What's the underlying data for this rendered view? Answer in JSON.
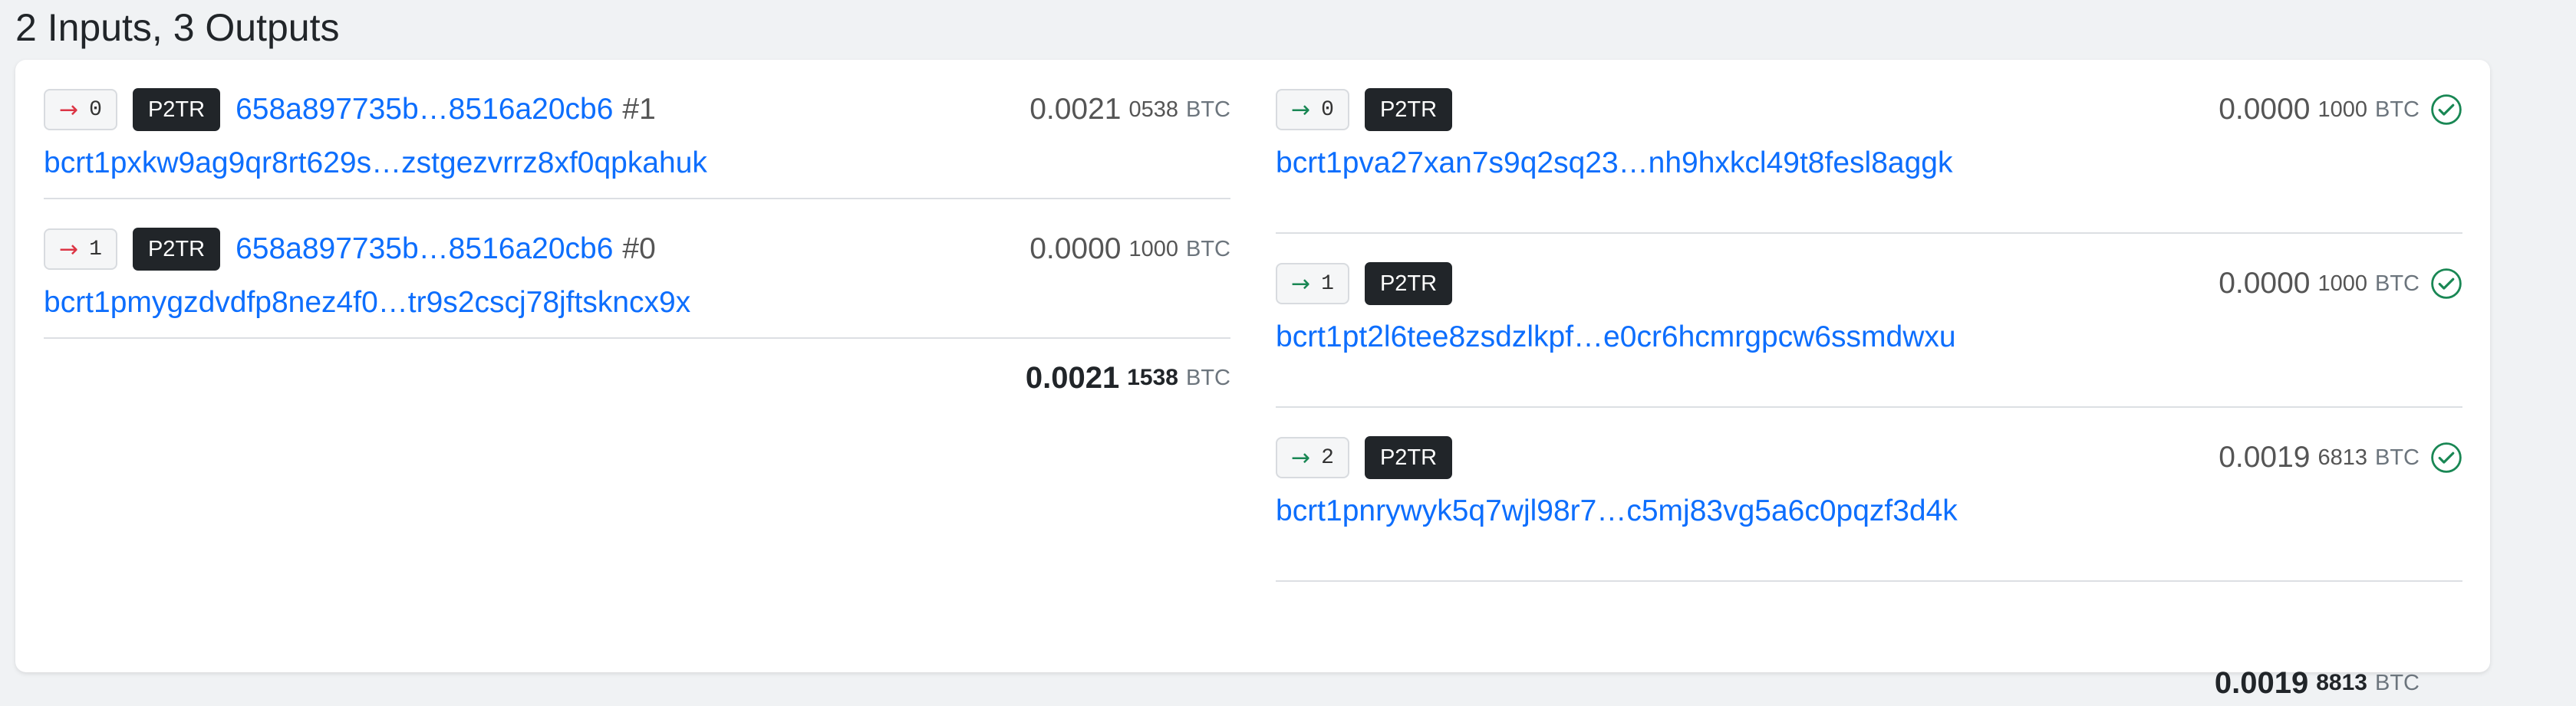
{
  "heading": "2 Inputs, 3 Outputs",
  "colors": {
    "link": "#0d6efd",
    "input_arrow": "#dc3545",
    "output_arrow": "#198754",
    "badge_bg": "#212529"
  },
  "inputs": [
    {
      "arrow": "→",
      "index": "0",
      "type": "P2TR",
      "txid": "658a897735b…8516a20cb6",
      "vout": "#1",
      "amount_main": "0.0021",
      "amount_small": "0538",
      "unit": "BTC",
      "address": "bcrt1pxkw9ag9qr8rt629s…zstgezvrrz8xf0qpkahuk"
    },
    {
      "arrow": "→",
      "index": "1",
      "type": "P2TR",
      "txid": "658a897735b…8516a20cb6",
      "vout": "#0",
      "amount_main": "0.0000",
      "amount_small": "1000",
      "unit": "BTC",
      "address": "bcrt1pmygzdvdfp8nez4f0…tr9s2cscj78jftskncx9x"
    }
  ],
  "inputs_total": {
    "main": "0.0021",
    "small": "1538",
    "unit": "BTC"
  },
  "outputs": [
    {
      "arrow": "→",
      "index": "0",
      "type": "P2TR",
      "amount_main": "0.0000",
      "amount_small": "1000",
      "unit": "BTC",
      "status_icon": "check-circle-icon",
      "address": "bcrt1pva27xan7s9q2sq23…nh9hxkcl49t8fesl8aggk"
    },
    {
      "arrow": "→",
      "index": "1",
      "type": "P2TR",
      "amount_main": "0.0000",
      "amount_small": "1000",
      "unit": "BTC",
      "status_icon": "check-circle-icon",
      "address": "bcrt1pt2l6tee8zsdzlkpf…e0cr6hcmrgpcw6ssmdwxu"
    },
    {
      "arrow": "→",
      "index": "2",
      "type": "P2TR",
      "amount_main": "0.0019",
      "amount_small": "6813",
      "unit": "BTC",
      "status_icon": "check-circle-icon",
      "address": "bcrt1pnrywyk5q7wjl98r7…c5mj83vg5a6c0pqzf3d4k"
    }
  ],
  "outputs_total": {
    "main": "0.0019",
    "small": "8813",
    "unit": "BTC"
  }
}
